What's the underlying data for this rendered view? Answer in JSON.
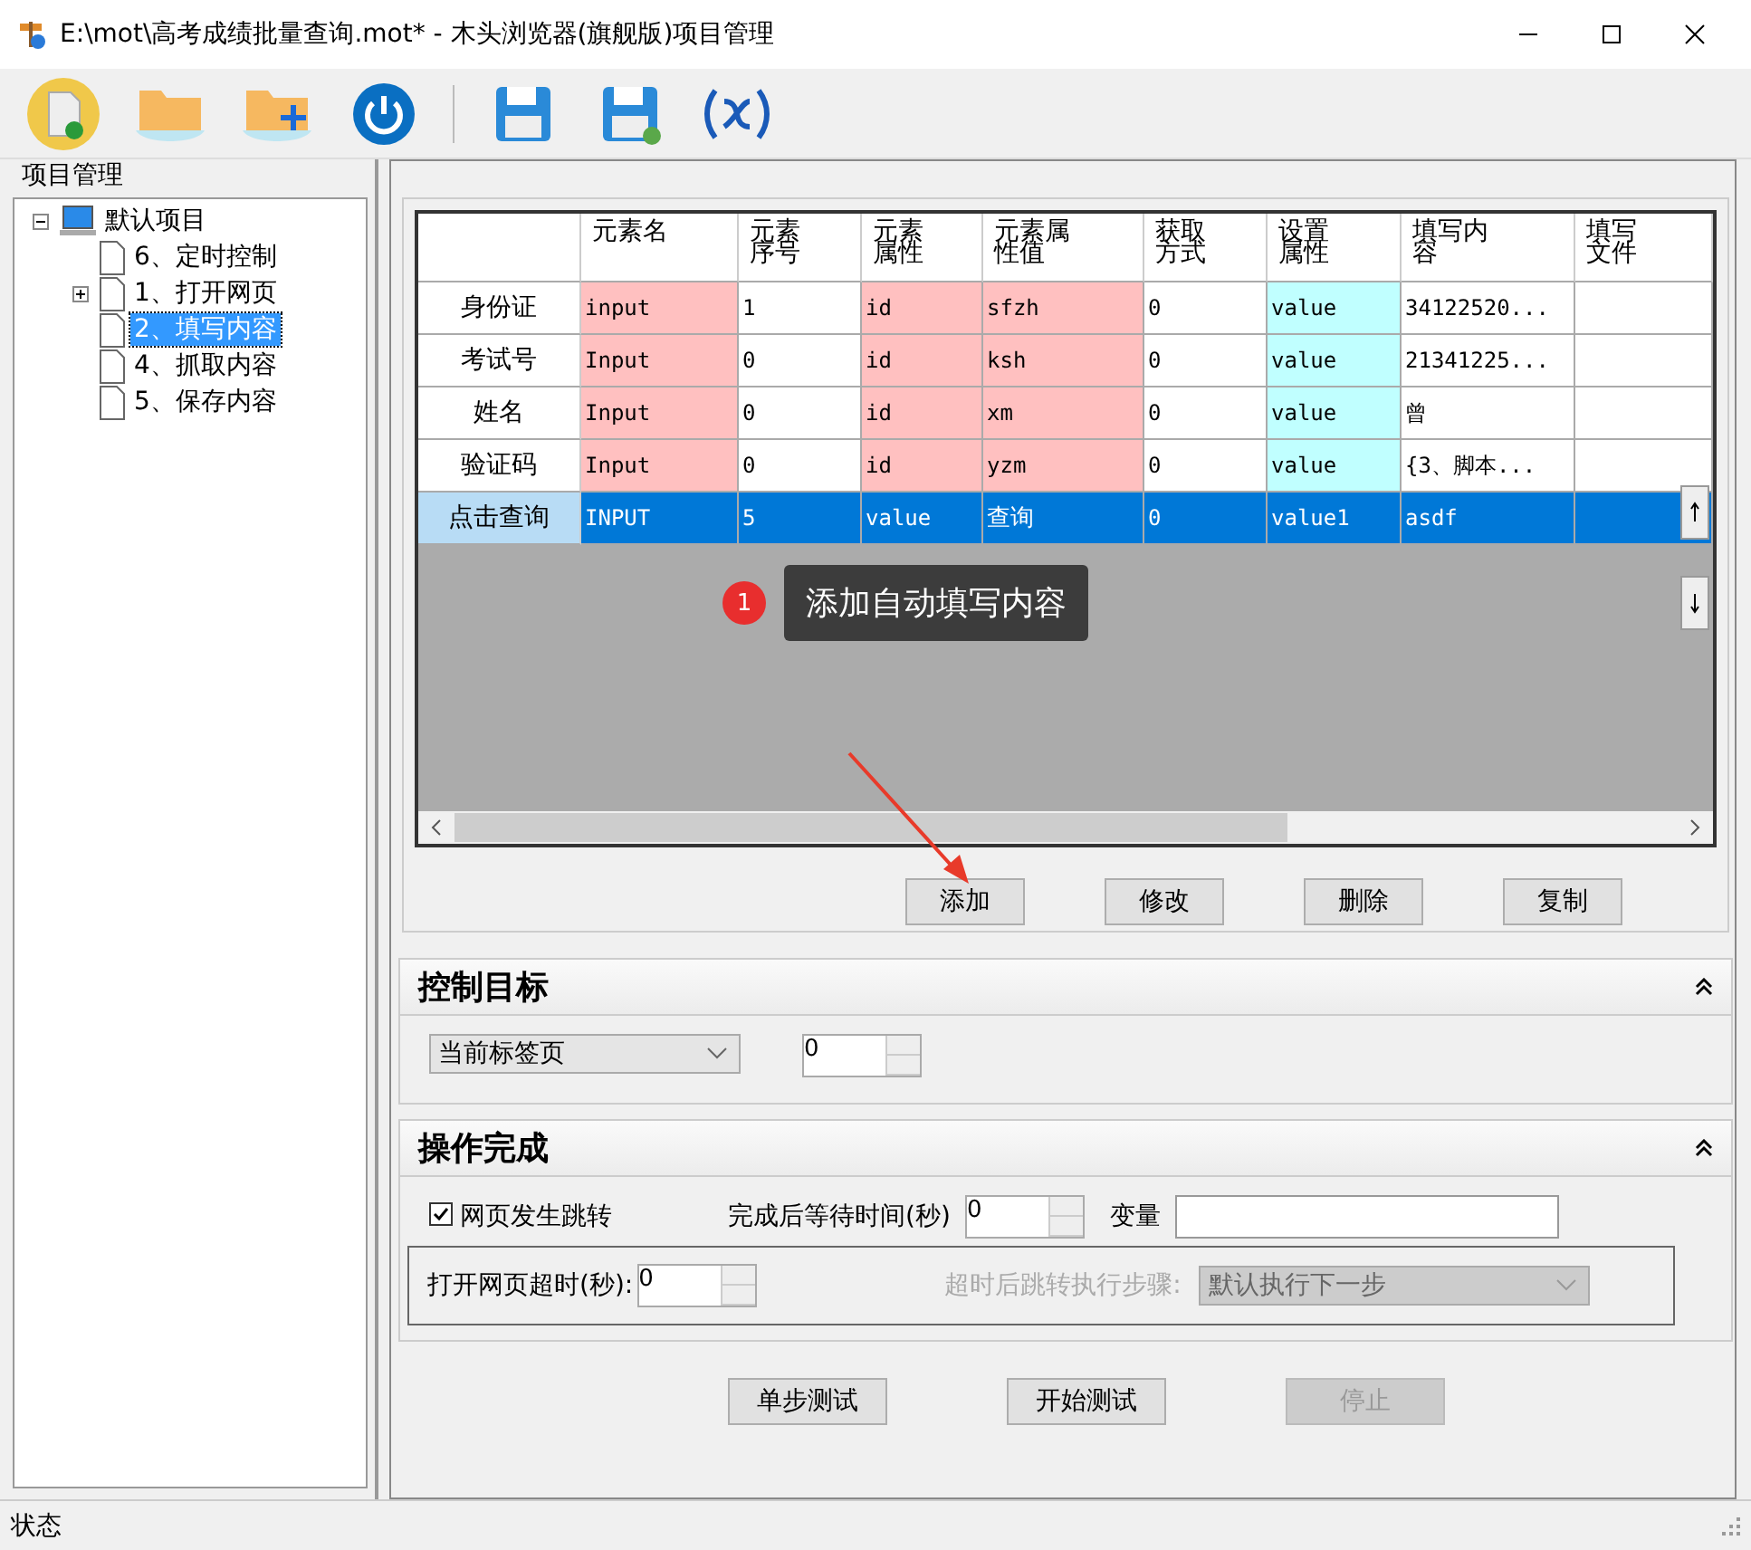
{
  "window": {
    "title": "E:\\mot\\高考成绩批量查询.mot* - 木头浏览器(旗舰版)项目管理"
  },
  "sidebar": {
    "title": "项目管理",
    "tree": [
      {
        "label": "默认项目",
        "expanded": true,
        "selected": false,
        "children": [
          {
            "label": "6、定时控制",
            "expander": false,
            "selected": false
          },
          {
            "label": "1、打开网页",
            "expander": true,
            "selected": false
          },
          {
            "label": "2、填写内容",
            "expander": false,
            "selected": true
          },
          {
            "label": "4、抓取内容",
            "expander": false,
            "selected": false
          },
          {
            "label": "5、保存内容",
            "expander": false,
            "selected": false
          }
        ]
      }
    ]
  },
  "table": {
    "columns": [
      {
        "label": "元素名",
        "color": "#ffc0c0"
      },
      {
        "label": "元素序号",
        "color": "#ffffff"
      },
      {
        "label": "元素属性",
        "color": "#ffc0c0"
      },
      {
        "label": "元素属性值",
        "color": "#ffc0c0"
      },
      {
        "label": "获取方式",
        "color": "#ffffff"
      },
      {
        "label": "设置属性",
        "color": "#c0ffff"
      },
      {
        "label": "填写内容",
        "color": "#ffffff"
      },
      {
        "label": "填写文件",
        "color": "#ffffff"
      }
    ],
    "rows": [
      {
        "header": "身份证",
        "selected": false,
        "cells": [
          "input",
          "1",
          "id",
          "sfzh",
          "0",
          "value",
          "34122520...",
          ""
        ]
      },
      {
        "header": "考试号",
        "selected": false,
        "cells": [
          "Input",
          "0",
          "id",
          "ksh",
          "0",
          "value",
          "21341225...",
          ""
        ]
      },
      {
        "header": "姓名",
        "selected": false,
        "cells": [
          "Input",
          "0",
          "id",
          "xm",
          "0",
          "value",
          "曾",
          ""
        ]
      },
      {
        "header": "验证码",
        "selected": false,
        "cells": [
          "Input",
          "0",
          "id",
          "yzm",
          "0",
          "value",
          "{3、脚本...",
          ""
        ]
      },
      {
        "header": "点击查询",
        "selected": true,
        "cells": [
          "INPUT",
          "5",
          "value",
          "查询",
          "0",
          "value1",
          "asdf",
          ""
        ]
      }
    ]
  },
  "callout": {
    "badge": "1",
    "text": "添加自动填写内容"
  },
  "table_buttons": [
    "添加",
    "修改",
    "删除",
    "复制"
  ],
  "control_target": {
    "title": "控制目标",
    "target": "当前标签页",
    "index": "0"
  },
  "completion": {
    "title": "操作完成",
    "redirect": {
      "label": "网页发生跳转",
      "checked": true
    },
    "wait_label": "完成后等待时间(秒)",
    "wait": "0",
    "variable_label": "变量",
    "timeout_label": "打开网页超时(秒):",
    "timeout": "0",
    "jump_label": "超时后跳转执行步骤:",
    "jump": "默认执行下一步",
    "jump_disabled": true
  },
  "test_buttons": [
    {
      "label": "单步测试",
      "disabled": false
    },
    {
      "label": "开始测试",
      "disabled": false
    },
    {
      "label": "停止",
      "disabled": true
    }
  ],
  "status_bar": "状态"
}
